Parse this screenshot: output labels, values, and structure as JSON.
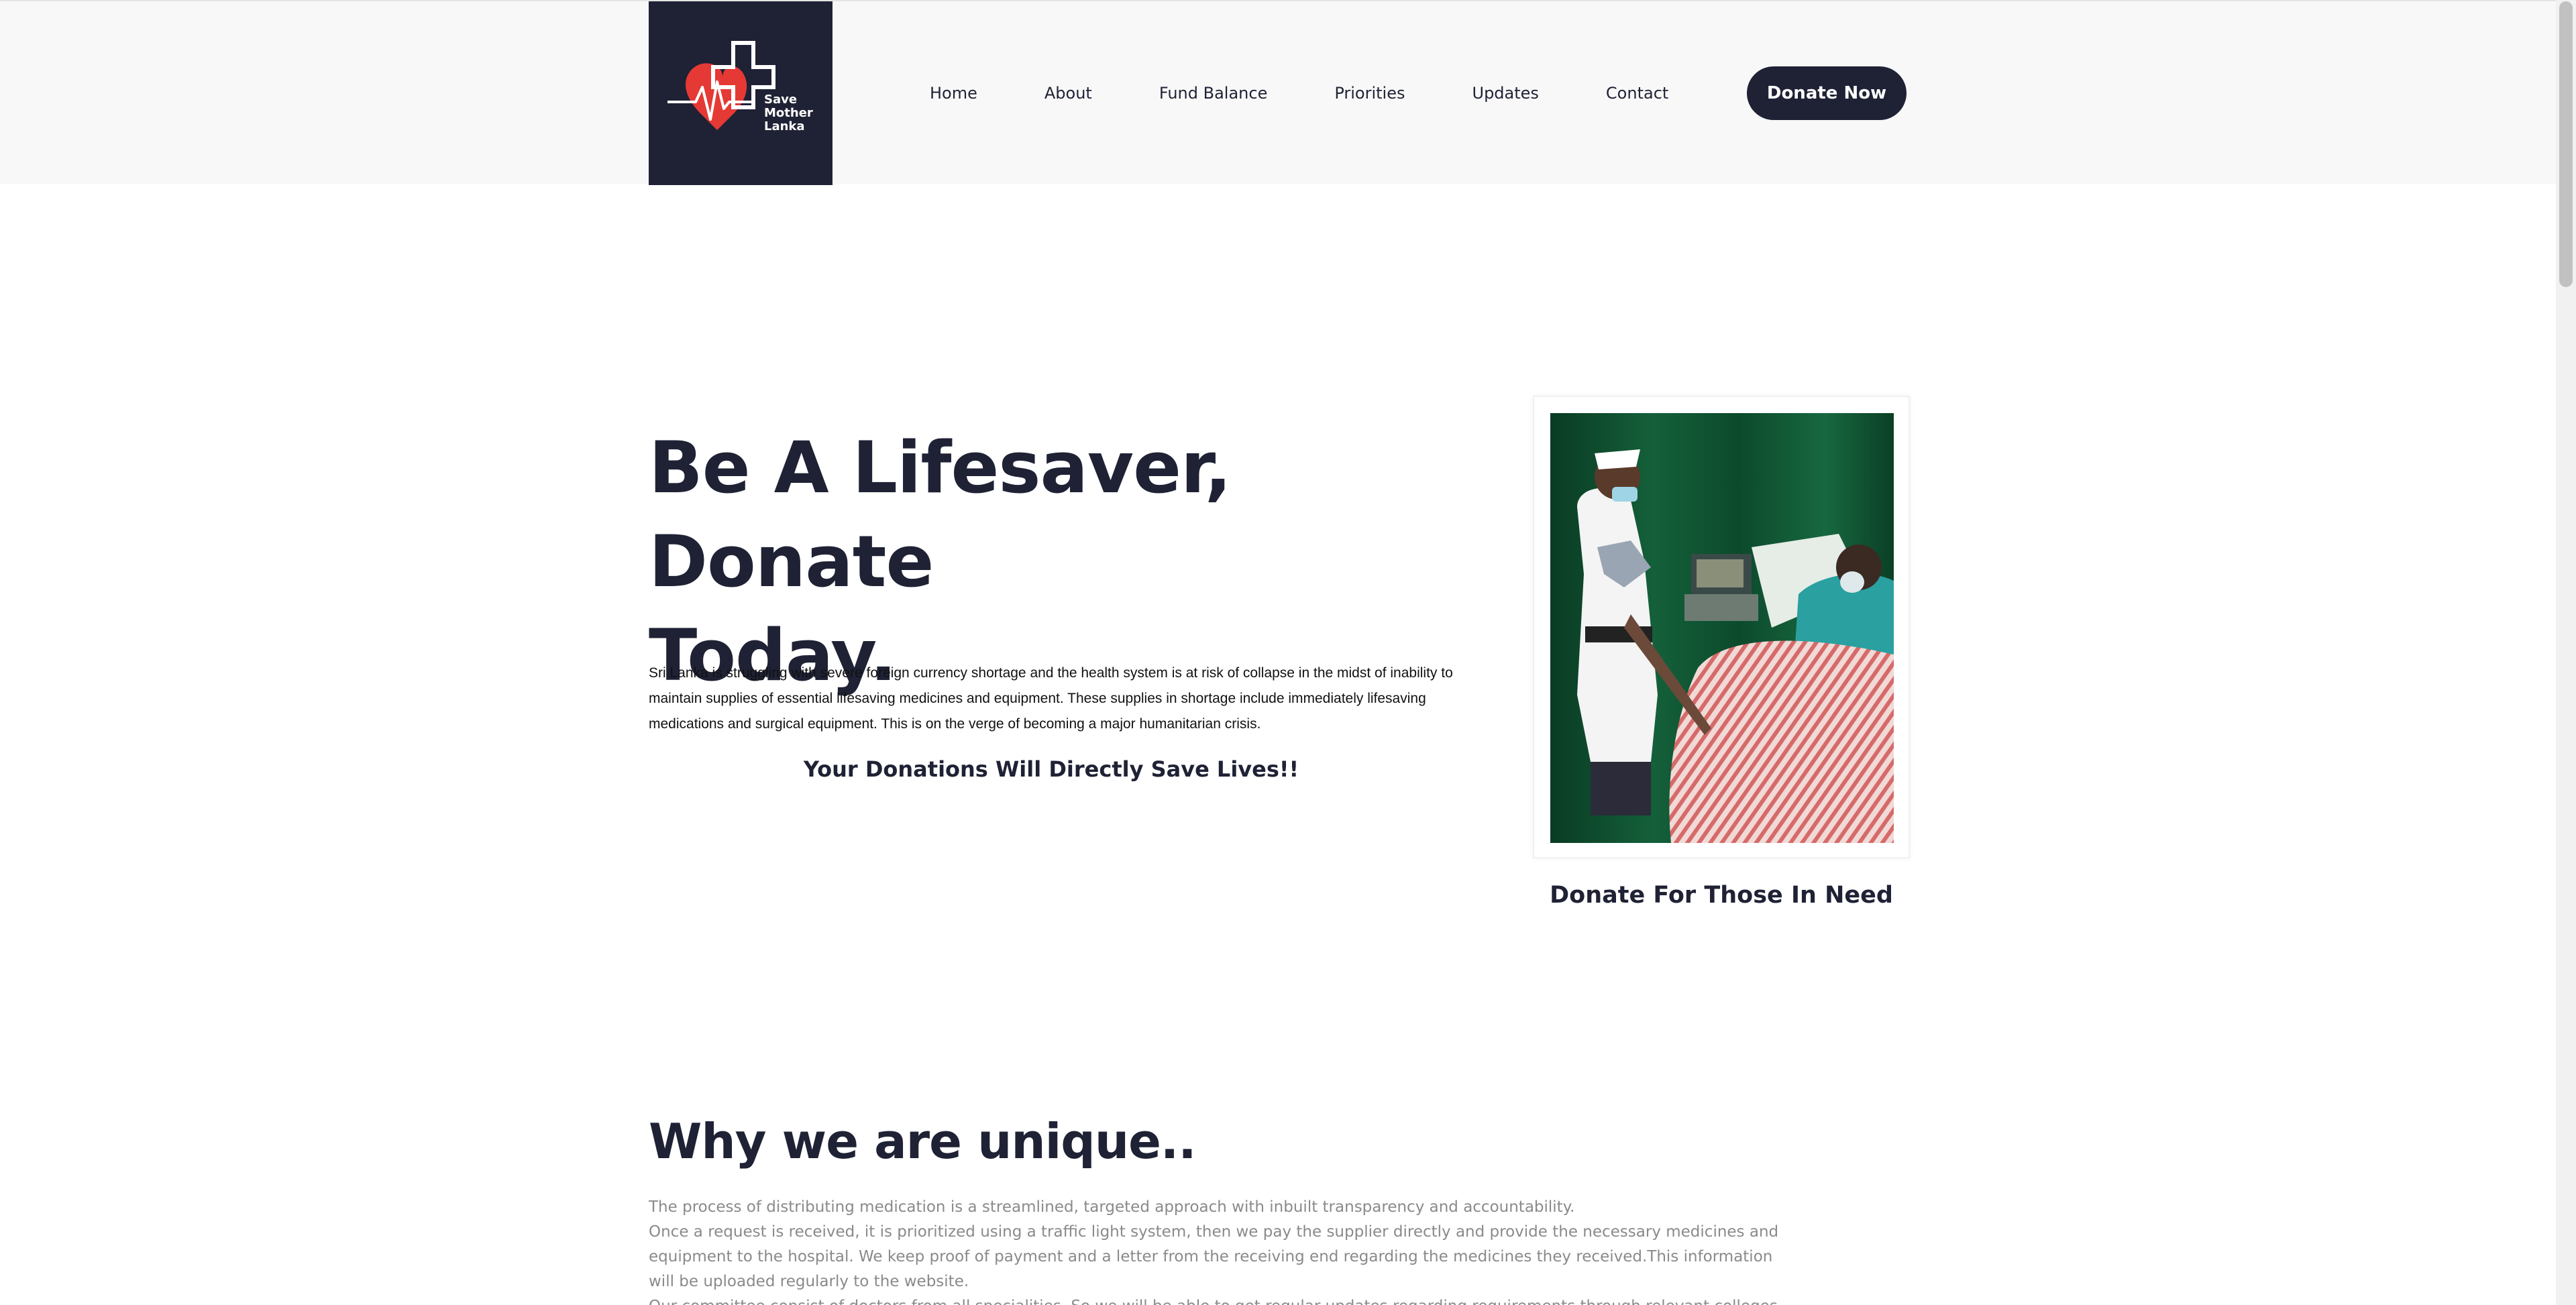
{
  "header": {
    "logo": {
      "line1": "Save",
      "line2": "Mother",
      "line3": "Lanka",
      "icon": "heart-cross-heartbeat-icon",
      "bg_color": "#1f2235",
      "heart_color": "#e53935"
    },
    "nav": [
      {
        "label": "Home"
      },
      {
        "label": "About"
      },
      {
        "label": "Fund Balance"
      },
      {
        "label": "Priorities"
      },
      {
        "label": "Updates"
      },
      {
        "label": "Contact"
      }
    ],
    "donate_button": "Donate Now"
  },
  "hero": {
    "title_line1": "Be A Lifesaver, Donate",
    "title_line2": "Today.",
    "text": "Sri Lanka is struggling with severe foreign currency shortage and the health system is at risk of collapse in the midst of inability to maintain supplies of essential lifesaving medicines and equipment. These supplies in shortage include immediately lifesaving medications and surgical equipment. This is on the verge of becoming a major humanitarian crisis.",
    "tagline": "Your Donations Will Directly Save Lives!!",
    "photo_caption": "Donate For Those In Need"
  },
  "unique": {
    "heading": "Why we are unique..",
    "paragraphs": [
      "The process of distributing medication is a streamlined, targeted approach with inbuilt transparency and accountability.",
      "Once a request is received, it is prioritized using a traffic light system, then we pay the supplier directly and provide the necessary medicines and equipment to the hospital. We keep proof of payment and a letter from the receiving end regarding the medicines they received.This information will be uploaded regularly to the website.",
      "Our committee consist of doctors from all specialities. So we will be able to get regular updates regarding requirements through relevant colleges."
    ]
  },
  "colors": {
    "primary": "#1f2235",
    "header_bg": "#f8f8f8",
    "muted_text": "#8a8a8a",
    "accent_red": "#e53935"
  }
}
